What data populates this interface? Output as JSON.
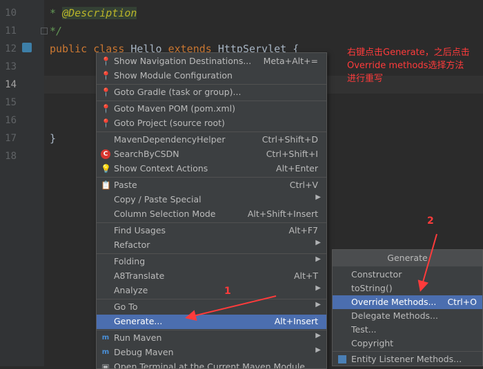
{
  "editor": {
    "line_numbers": [
      "10",
      "11",
      "12",
      "13",
      "14",
      "15",
      "16",
      "17",
      "18"
    ],
    "lines": {
      "l10_prefix": "* ",
      "l10_annotation": "@Description",
      "l11": "*/",
      "l12_kw_public": "public",
      "l12_kw_class": "class",
      "l12_name": "Hello",
      "l12_kw_extends": "extends",
      "l12_super": "HttpServlet {",
      "l17": "}"
    }
  },
  "context_menu": {
    "items": [
      {
        "label": "Show Navigation Destinations...",
        "shortcut": "Meta+Alt+=",
        "icon": "location-pin-icon"
      },
      {
        "label": "Show Module Configuration",
        "shortcut": "",
        "icon": "location-pin-icon"
      },
      {
        "label": "Goto Gradle (task or group)...",
        "shortcut": "",
        "icon": "location-pin-icon"
      },
      {
        "label": "Goto Maven POM (pom.xml)",
        "shortcut": "",
        "icon": "location-pin-icon"
      },
      {
        "label": "Goto Project (source root)",
        "shortcut": "",
        "icon": "location-pin-icon"
      },
      {
        "label": "MavenDependencyHelper",
        "shortcut": "Ctrl+Shift+D",
        "icon": ""
      },
      {
        "label": "SearchByCSDN",
        "shortcut": "Ctrl+Shift+I",
        "icon": "csdn-icon"
      },
      {
        "label": "Show Context Actions",
        "shortcut": "Alt+Enter",
        "icon": "lightbulb-icon"
      },
      {
        "label": "Paste",
        "shortcut": "Ctrl+V",
        "icon": "clipboard-icon"
      },
      {
        "label": "Copy / Paste Special",
        "shortcut": "",
        "icon": ""
      },
      {
        "label": "Column Selection Mode",
        "shortcut": "Alt+Shift+Insert",
        "icon": ""
      },
      {
        "label": "Find Usages",
        "shortcut": "Alt+F7",
        "icon": ""
      },
      {
        "label": "Refactor",
        "shortcut": "",
        "icon": ""
      },
      {
        "label": "Folding",
        "shortcut": "",
        "icon": ""
      },
      {
        "label": "A8Translate",
        "shortcut": "Alt+T",
        "icon": ""
      },
      {
        "label": "Analyze",
        "shortcut": "",
        "icon": ""
      },
      {
        "label": "Go To",
        "shortcut": "",
        "icon": ""
      },
      {
        "label": "Generate...",
        "shortcut": "Alt+Insert",
        "icon": ""
      },
      {
        "label": "Run Maven",
        "shortcut": "",
        "icon": "maven-icon"
      },
      {
        "label": "Debug Maven",
        "shortcut": "",
        "icon": "maven-icon"
      },
      {
        "label": "Open Terminal at the Current Maven Module Path",
        "shortcut": "",
        "icon": "terminal-icon"
      }
    ],
    "selected": "Generate...",
    "submenu_arrow": "▶"
  },
  "generate_menu": {
    "title": "Generate",
    "items": [
      {
        "label": "Constructor",
        "shortcut": ""
      },
      {
        "label": "toString()",
        "shortcut": ""
      },
      {
        "label": "Override Methods...",
        "shortcut": "Ctrl+O"
      },
      {
        "label": "Delegate Methods...",
        "shortcut": ""
      },
      {
        "label": "Test...",
        "shortcut": ""
      },
      {
        "label": "Copyright",
        "shortcut": ""
      },
      {
        "label": "Entity Listener Methods...",
        "shortcut": ""
      }
    ],
    "selected": "Override Methods..."
  },
  "annotation": {
    "note_line1": "右键点击Generate，之后点击",
    "note_line2": "Override methods选择方法",
    "note_line3": "进行重写",
    "step1": "1",
    "step2": "2",
    "color": "#ff3b3b"
  },
  "colors": {
    "editor_bg": "#2b2b2b",
    "menu_bg": "#3c3f41",
    "selection": "#4b6eaf",
    "keyword": "#cc7832",
    "doc_comment": "#629755"
  }
}
